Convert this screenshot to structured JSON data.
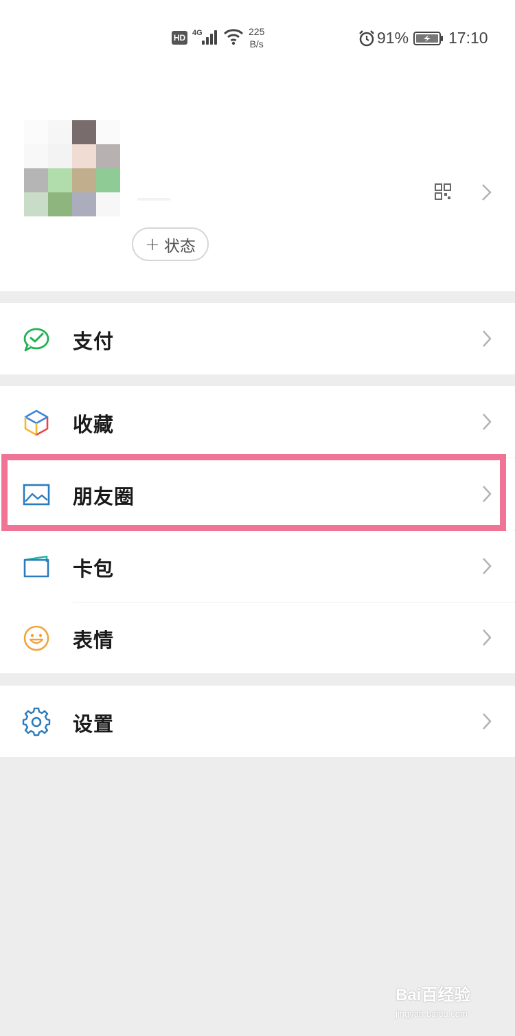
{
  "status_bar": {
    "hd_badge": "HD",
    "network_type": "4G",
    "speed_value": "225",
    "speed_unit": "B/s",
    "battery_percent": "91%",
    "time": "17:10"
  },
  "profile": {
    "status_button_plus": "+",
    "status_button_label": "状态"
  },
  "menu": {
    "pay": "支付",
    "favorites": "收藏",
    "moments": "朋友圈",
    "cards": "卡包",
    "stickers": "表情",
    "settings": "设置"
  },
  "colors": {
    "highlight_border": "#f07496",
    "pay_icon": "#21b150",
    "moments_icon": "#2b7bbd",
    "stickers_icon": "#f2a33a",
    "settings_icon": "#2b7bbd"
  },
  "watermark": {
    "brand": "Bai百经验",
    "url": "jingyan.baidu.com"
  }
}
